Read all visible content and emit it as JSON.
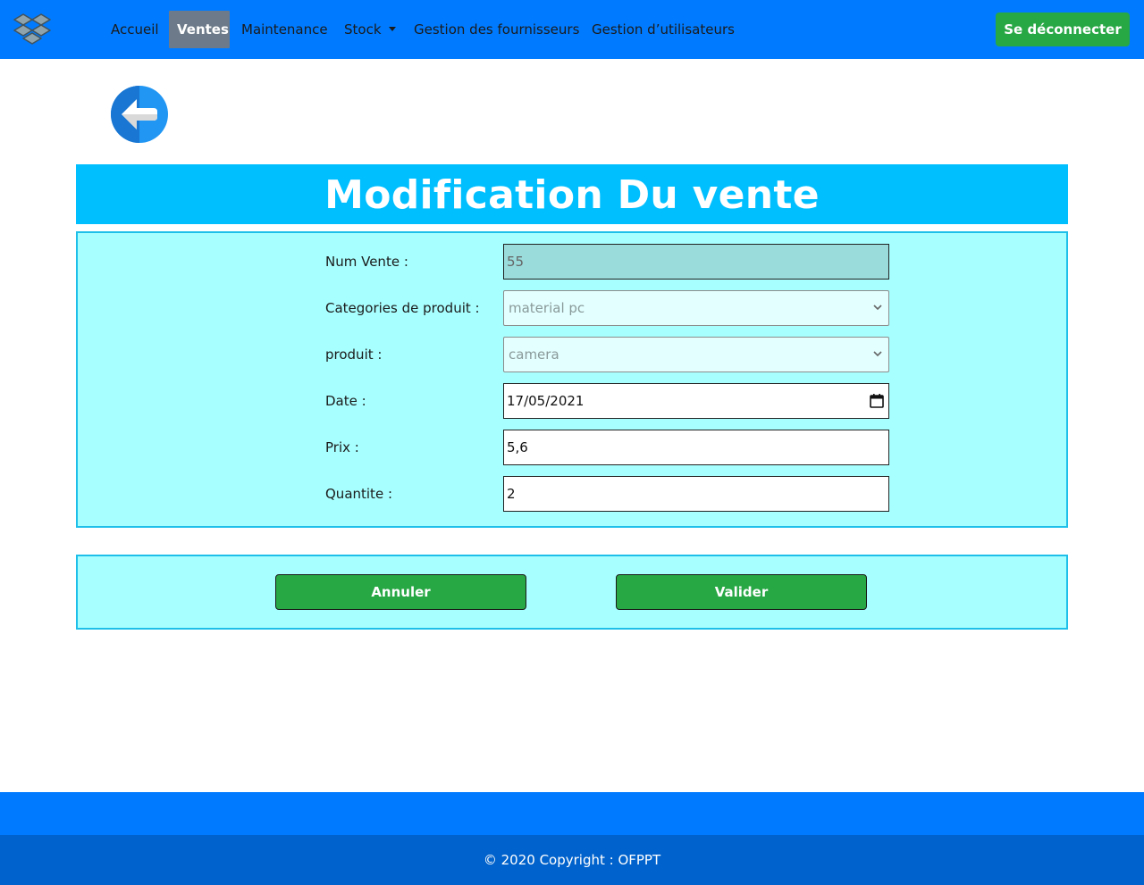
{
  "navbar": {
    "logo_icon": "dropbox-logo-icon",
    "items": [
      {
        "label": "Accueil"
      },
      {
        "label": "Ventes"
      },
      {
        "label": "Maintenance"
      },
      {
        "label": "Stock"
      },
      {
        "label": "Gestion des fournisseurs"
      },
      {
        "label": "Gestion d’utilisateurs"
      }
    ],
    "active_item": "Ventes",
    "logout_label": "Se déconnecter"
  },
  "back_button_icon": "arrow-left-circle-icon",
  "title": "Modification Du vente",
  "form": {
    "num_vente": {
      "label": "Num Vente :",
      "value": "55"
    },
    "categorie": {
      "label": "Categories de produit :",
      "value": "material pc"
    },
    "produit": {
      "label": "produit :",
      "value": "camera"
    },
    "date": {
      "label": "Date :",
      "value": "17/05/2021"
    },
    "prix": {
      "label": "Prix :",
      "value": "5,6"
    },
    "quantite": {
      "label": "Quantite :",
      "value": "2"
    }
  },
  "actions": {
    "cancel_label": "Annuler",
    "submit_label": "Valider"
  },
  "footer": {
    "copyright": "© 2020 Copyright : OFPPT"
  },
  "colors": {
    "primary": "#007bff",
    "success": "#28a745",
    "title_bg": "#00bfff",
    "panel_bg": "#a8ffff",
    "footer_dark": "#0062cc"
  }
}
